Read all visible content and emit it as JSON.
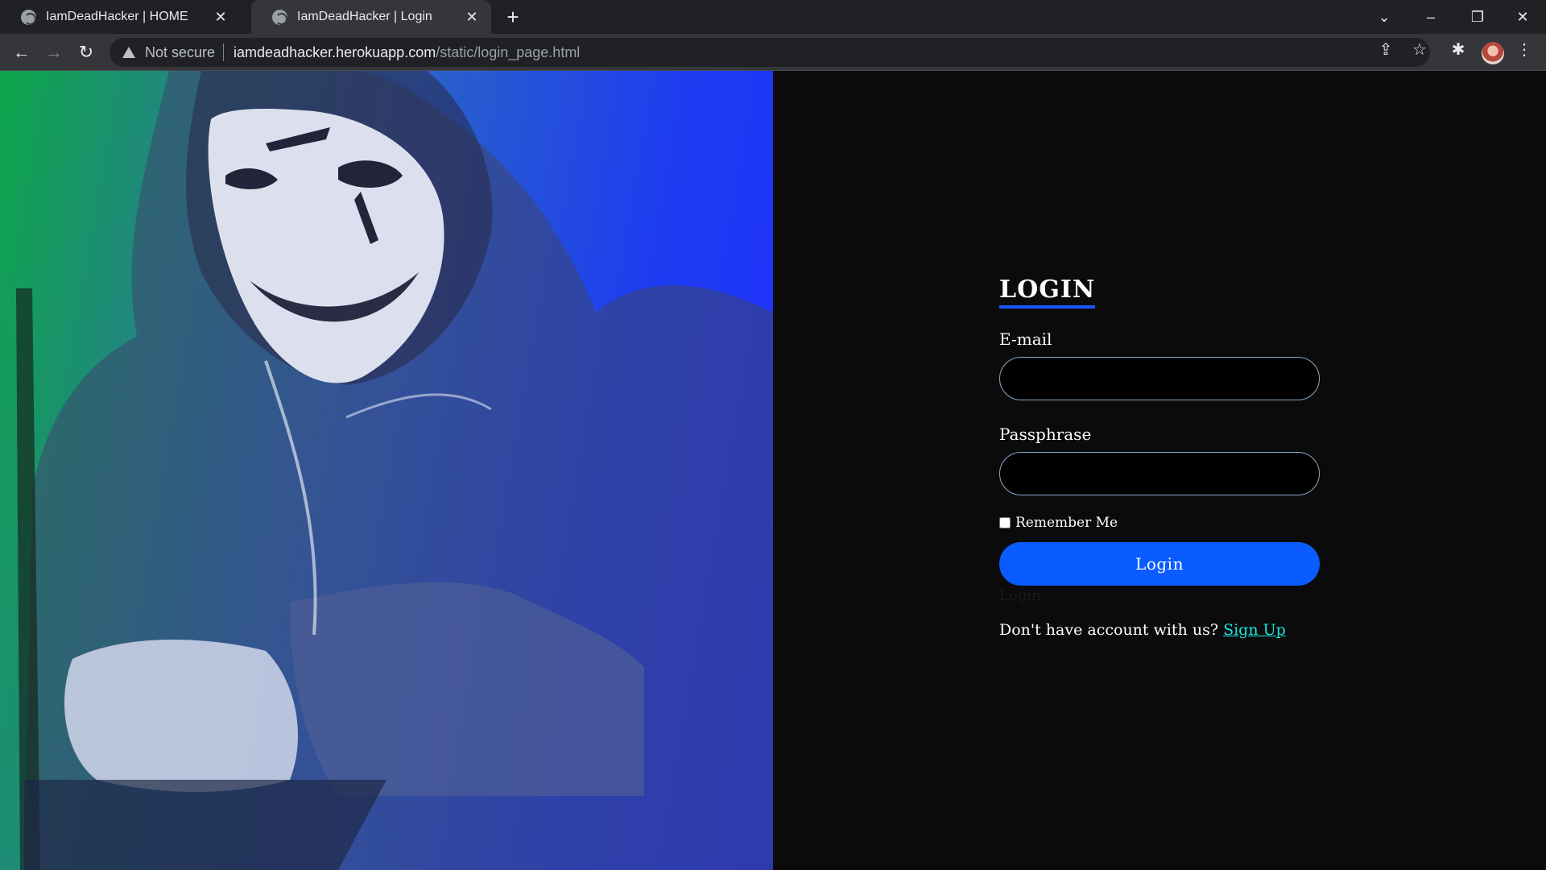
{
  "browser": {
    "tabs": [
      {
        "title": "IamDeadHacker | HOME",
        "active": false
      },
      {
        "title": "IamDeadHacker | Login",
        "active": true
      }
    ],
    "address_bar": {
      "security_label": "Not secure",
      "host": "iamdeadhacker.herokuapp.com",
      "path": "/static/login_page.html"
    }
  },
  "login": {
    "title": "LOGIN",
    "email_label": "E-mail",
    "email_value": "",
    "password_label": "Passphrase",
    "password_value": "",
    "remember_label": "Remember Me",
    "remember_checked": false,
    "button_label": "Login",
    "hidden_label": "Login",
    "signup_prompt": "Don't have account with us?",
    "signup_link": "Sign Up"
  },
  "colors": {
    "accent": "#0a5cff",
    "link": "#16e6e0",
    "background": "#0b0b0b",
    "hero_gradient_start": "#0da54a",
    "hero_gradient_end": "#1f2cff"
  }
}
